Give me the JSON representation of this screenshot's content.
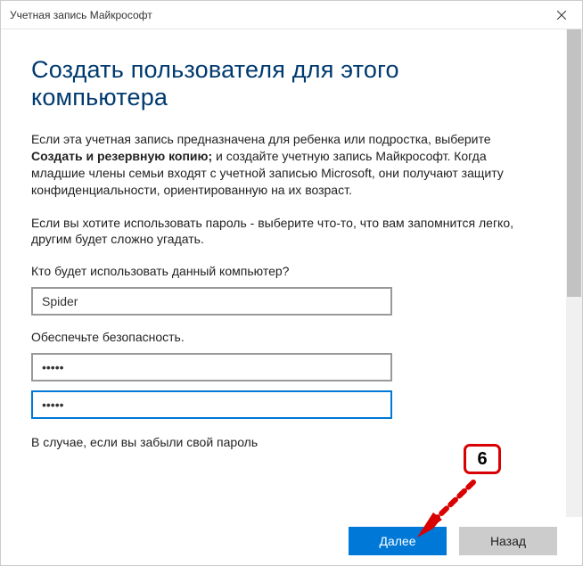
{
  "titlebar": {
    "title": "Учетная запись Майкрософт"
  },
  "heading": "Создать пользователя для этого компьютера",
  "intro": {
    "prefix": "Если эта учетная запись предназначена для ребенка или подростка, выберите ",
    "bold": "Создать и резервную копию;",
    "suffix": " и создайте учетную запись Майкрософт. Когда младшие члены семьи входят с учетной записью Microsoft, они получают защиту конфиденциальности, ориентированную на их возраст."
  },
  "password_advice": "Если вы хотите использовать пароль - выберите что-то, что вам запомнится легко, другим будет сложно угадать.",
  "username_label": "Кто будет использовать данный компьютер?",
  "username_value": "Spider",
  "security_label": "Обеспечьте безопасность.",
  "password_value": "•••••",
  "confirm_value": "•••••",
  "forgot_hint": "В случае, если вы забыли свой пароль",
  "buttons": {
    "next": "Далее",
    "back": "Назад"
  },
  "annotation": {
    "number": "6"
  }
}
